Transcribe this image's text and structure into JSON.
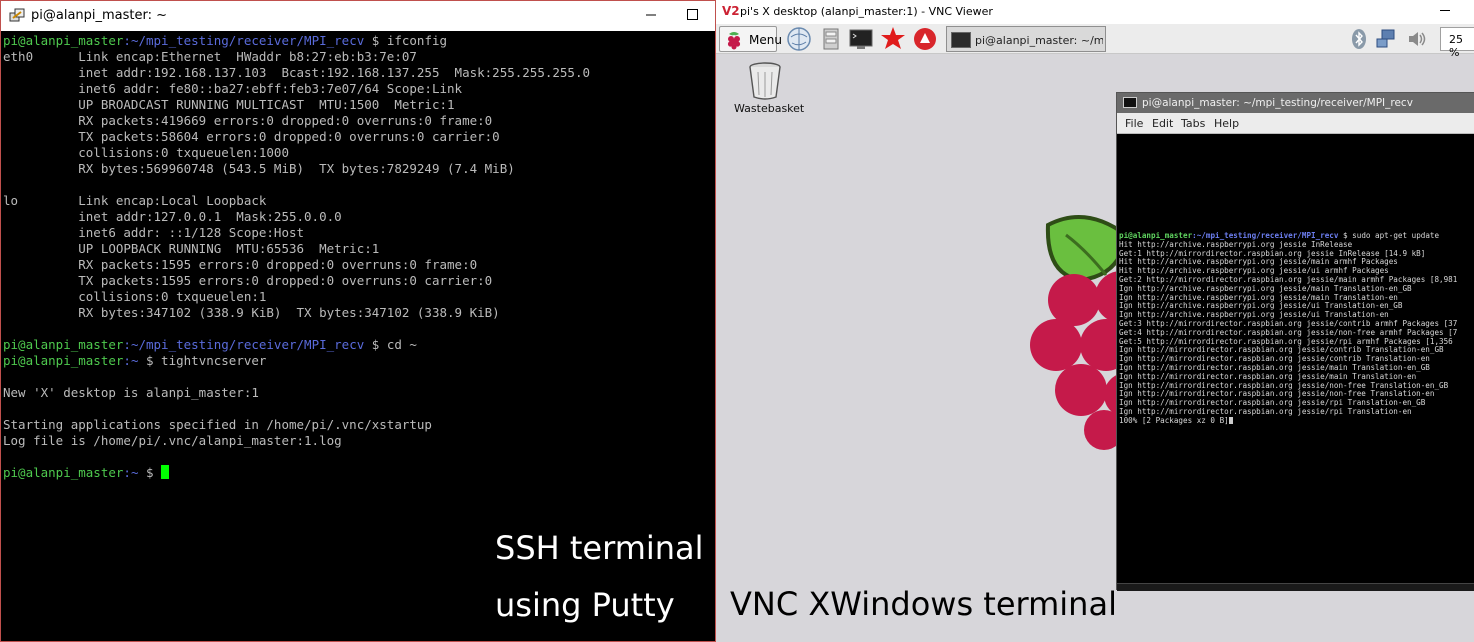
{
  "putty": {
    "title": "pi@alanpi_master: ~",
    "terminal": [
      {
        "prompt": "pi@alanpi_master",
        "path": ":~/mpi_testing/receiver/MPI_recv",
        "cmd": " $ ifconfig"
      },
      {
        "text": "eth0      Link encap:Ethernet  HWaddr b8:27:eb:b3:7e:07"
      },
      {
        "text": "          inet addr:192.168.137.103  Bcast:192.168.137.255  Mask:255.255.255.0"
      },
      {
        "text": "          inet6 addr: fe80::ba27:ebff:feb3:7e07/64 Scope:Link"
      },
      {
        "text": "          UP BROADCAST RUNNING MULTICAST  MTU:1500  Metric:1"
      },
      {
        "text": "          RX packets:419669 errors:0 dropped:0 overruns:0 frame:0"
      },
      {
        "text": "          TX packets:58604 errors:0 dropped:0 overruns:0 carrier:0"
      },
      {
        "text": "          collisions:0 txqueuelen:1000"
      },
      {
        "text": "          RX bytes:569960748 (543.5 MiB)  TX bytes:7829249 (7.4 MiB)"
      },
      {
        "text": ""
      },
      {
        "text": "lo        Link encap:Local Loopback"
      },
      {
        "text": "          inet addr:127.0.0.1  Mask:255.0.0.0"
      },
      {
        "text": "          inet6 addr: ::1/128 Scope:Host"
      },
      {
        "text": "          UP LOOPBACK RUNNING  MTU:65536  Metric:1"
      },
      {
        "text": "          RX packets:1595 errors:0 dropped:0 overruns:0 frame:0"
      },
      {
        "text": "          TX packets:1595 errors:0 dropped:0 overruns:0 carrier:0"
      },
      {
        "text": "          collisions:0 txqueuelen:1"
      },
      {
        "text": "          RX bytes:347102 (338.9 KiB)  TX bytes:347102 (338.9 KiB)"
      },
      {
        "text": ""
      },
      {
        "prompt": "pi@alanpi_master",
        "path": ":~/mpi_testing/receiver/MPI_recv",
        "cmd": " $ cd ~"
      },
      {
        "prompt": "pi@alanpi_master",
        "path": ":~",
        "cmd": " $ tightvncserver"
      },
      {
        "text": ""
      },
      {
        "text": "New 'X' desktop is alanpi_master:1"
      },
      {
        "text": ""
      },
      {
        "text": "Starting applications specified in /home/pi/.vnc/xstartup"
      },
      {
        "text": "Log file is /home/pi/.vnc/alanpi_master:1.log"
      },
      {
        "text": ""
      },
      {
        "prompt": "pi@alanpi_master",
        "path": ":~",
        "cmd": " $ ",
        "cursor": true
      }
    ],
    "caption_line1": "SSH terminal",
    "caption_line2": "using Putty"
  },
  "vnc": {
    "title_logo": "V2",
    "title": "pi's X desktop (alanpi_master:1) - VNC Viewer",
    "menu_label": "Menu",
    "taskbar_item": "pi@alanpi_master: ~/mpi_t...",
    "cpu": "25 %",
    "wastebasket": "Wastebasket",
    "lx_title": "pi@alanpi_master: ~/mpi_testing/receiver/MPI_recv",
    "lx_menu": [
      "File",
      "Edit",
      "Tabs",
      "Help"
    ],
    "lx_terminal": [
      {
        "prompt": "pi@alanpi_master",
        "path": ":~/mpi_testing/receiver/MPI_recv",
        "cmd": " $ sudo apt-get update"
      },
      {
        "text": "Hit http://archive.raspberrypi.org jessie InRelease"
      },
      {
        "text": "Get:1 http://mirrordirector.raspbian.org jessie InRelease [14.9 kB]"
      },
      {
        "text": "Hit http://archive.raspberrypi.org jessie/main armhf Packages"
      },
      {
        "text": "Hit http://archive.raspberrypi.org jessie/ui armhf Packages"
      },
      {
        "text": "Get:2 http://mirrordirector.raspbian.org jessie/main armhf Packages [8,981"
      },
      {
        "text": "Ign http://archive.raspberrypi.org jessie/main Translation-en_GB"
      },
      {
        "text": "Ign http://archive.raspberrypi.org jessie/main Translation-en"
      },
      {
        "text": "Ign http://archive.raspberrypi.org jessie/ui Translation-en_GB"
      },
      {
        "text": "Ign http://archive.raspberrypi.org jessie/ui Translation-en"
      },
      {
        "text": "Get:3 http://mirrordirector.raspbian.org jessie/contrib armhf Packages [37"
      },
      {
        "text": "Get:4 http://mirrordirector.raspbian.org jessie/non-free armhf Packages [7"
      },
      {
        "text": "Get:5 http://mirrordirector.raspbian.org jessie/rpi armhf Packages [1,356"
      },
      {
        "text": "Ign http://mirrordirector.raspbian.org jessie/contrib Translation-en_GB"
      },
      {
        "text": "Ign http://mirrordirector.raspbian.org jessie/contrib Translation-en"
      },
      {
        "text": "Ign http://mirrordirector.raspbian.org jessie/main Translation-en_GB"
      },
      {
        "text": "Ign http://mirrordirector.raspbian.org jessie/main Translation-en"
      },
      {
        "text": "Ign http://mirrordirector.raspbian.org jessie/non-free Translation-en_GB"
      },
      {
        "text": "Ign http://mirrordirector.raspbian.org jessie/non-free Translation-en"
      },
      {
        "text": "Ign http://mirrordirector.raspbian.org jessie/rpi Translation-en_GB"
      },
      {
        "text": "Ign http://mirrordirector.raspbian.org jessie/rpi Translation-en"
      },
      {
        "text": "100% [2 Packages xz 0 B]",
        "cursor": true
      }
    ],
    "caption": "VNC XWindows terminal"
  }
}
